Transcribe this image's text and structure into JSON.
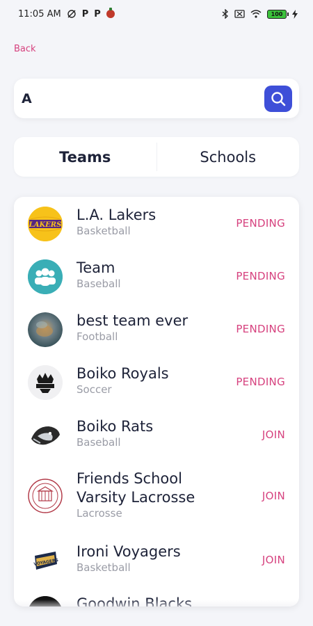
{
  "status_bar": {
    "time": "11:05 AM",
    "left_icons": [
      "mute-icon",
      "p-icon",
      "p-icon",
      "tomato-icon"
    ],
    "p_label": "P",
    "battery": "100",
    "right_icons": [
      "bluetooth-icon",
      "sim-icon",
      "wifi-icon",
      "battery-icon",
      "charging-icon"
    ]
  },
  "nav": {
    "back_label": "Back"
  },
  "search": {
    "value": "A",
    "button_icon": "search-icon",
    "button_color": "#3e4fd8"
  },
  "tabs": [
    {
      "label": "Teams",
      "active": true
    },
    {
      "label": "Schools",
      "active": false
    }
  ],
  "colors": {
    "accent": "#d6417e",
    "primary": "#3e4fd8",
    "text": "#1d2238",
    "muted": "#9a9ca6"
  },
  "results": [
    {
      "name": "L.A. Lakers",
      "sport": "Basketball",
      "status": "PENDING",
      "avatar_icon": "lakers-logo"
    },
    {
      "name": "Team",
      "sport": "Baseball",
      "status": "PENDING",
      "avatar_icon": "group-icon"
    },
    {
      "name": "best team ever",
      "sport": "Football",
      "status": "PENDING",
      "avatar_icon": "photo-avatar"
    },
    {
      "name": "Boiko Royals",
      "sport": "Soccer",
      "status": "PENDING",
      "avatar_icon": "royals-logo"
    },
    {
      "name": "Boiko Rats",
      "sport": "Baseball",
      "status": "JOIN",
      "avatar_icon": "rats-logo"
    },
    {
      "name_line1": "Friends School",
      "name_line2": "Varsity Lacrosse",
      "sport": "Lacrosse",
      "status": "JOIN",
      "avatar_icon": "school-seal-logo"
    },
    {
      "name": "Ironi Voyagers",
      "sport": "Basketball",
      "status": "JOIN",
      "avatar_icon": "voyagers-logo"
    },
    {
      "name": "Goodwin Blacks",
      "avatar_icon": "blacks-logo"
    }
  ]
}
